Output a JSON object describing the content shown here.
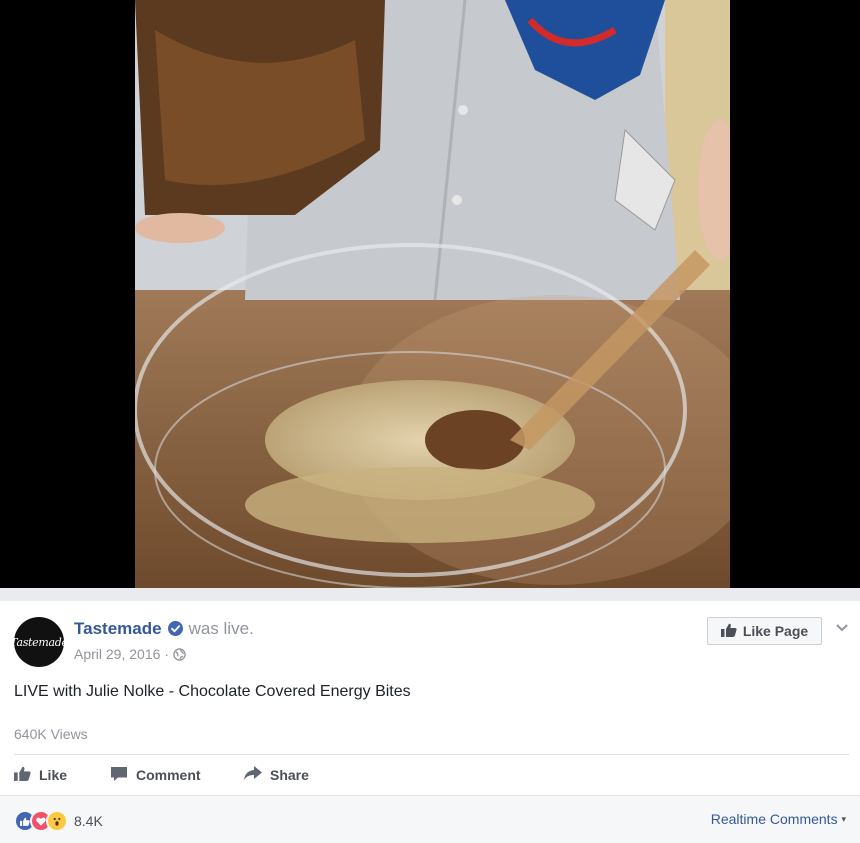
{
  "post": {
    "page_name": "Tastemade",
    "verified_icon": "verified-check-icon",
    "status_text": "was live.",
    "date": "April 29, 2016",
    "separator": "·",
    "privacy_icon": "globe-icon",
    "avatar_logo_text": "Tastemade",
    "like_page_label": "Like Page",
    "title": "LIVE with Julie Nolke - Chocolate Covered Energy Bites",
    "views": "640K Views"
  },
  "actions": {
    "like_label": "Like",
    "comment_label": "Comment",
    "share_label": "Share"
  },
  "footer": {
    "reaction_icons": [
      "like-reaction-icon",
      "love-reaction-icon",
      "wow-reaction-icon"
    ],
    "reaction_count": "8.4K",
    "realtime_label": "Realtime Comments",
    "realtime_caret": "▾"
  },
  "colors": {
    "link_blue": "#365899",
    "fb_blue": "#4267b2",
    "love_red": "#f25268",
    "wow_yellow": "#fcc840",
    "muted_gray": "#90949c"
  }
}
